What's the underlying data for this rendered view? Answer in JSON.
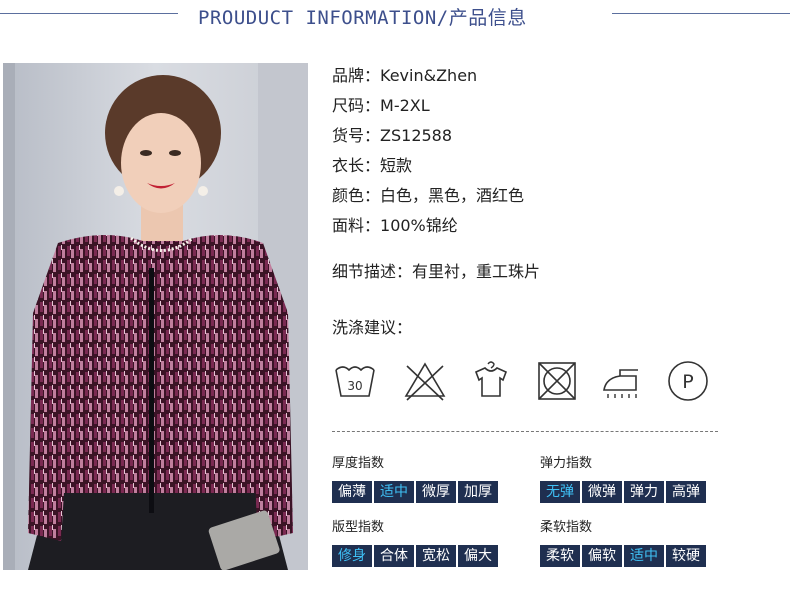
{
  "header": {
    "title": "PROUDUCT INFORMATION/产品信息"
  },
  "info": [
    {
      "label": "品牌：",
      "value": "Kevin&Zhen"
    },
    {
      "label": "尺码：",
      "value": "M-2XL"
    },
    {
      "label": "货号：",
      "value": "ZS12588"
    },
    {
      "label": "衣长：",
      "value": "短款"
    },
    {
      "label": "颜色：",
      "value": "白色，黑色，酒红色"
    },
    {
      "label": "面料：",
      "value": "100%锦纶"
    }
  ],
  "detail": {
    "label": "细节描述：",
    "value": "有里衬，重工珠片"
  },
  "wash": {
    "title": "洗涤建议：",
    "icons": [
      "wash-30-icon",
      "no-bleach-icon",
      "hang-dry-icon",
      "no-tumble-dry-icon",
      "iron-icon",
      "dry-clean-p-icon"
    ],
    "temp": "30",
    "p": "P"
  },
  "indices": {
    "thickness": {
      "label": "厚度指数",
      "options": [
        "偏薄",
        "适中",
        "微厚",
        "加厚"
      ],
      "selected": 1
    },
    "elasticity": {
      "label": "弹力指数",
      "options": [
        "无弹",
        "微弹",
        "弹力",
        "高弹"
      ],
      "selected": 0
    },
    "fit": {
      "label": "版型指数",
      "options": [
        "修身",
        "合体",
        "宽松",
        "偏大"
      ],
      "selected": 0
    },
    "softness": {
      "label": "柔软指数",
      "options": [
        "柔软",
        "偏软",
        "适中",
        "较硬"
      ],
      "selected": 2
    }
  },
  "colors": {
    "accent": "#3d4f8c",
    "tag_bg": "#1f2f50",
    "tag_selected": "#3fc0f5",
    "garment": "#4a1b30"
  }
}
